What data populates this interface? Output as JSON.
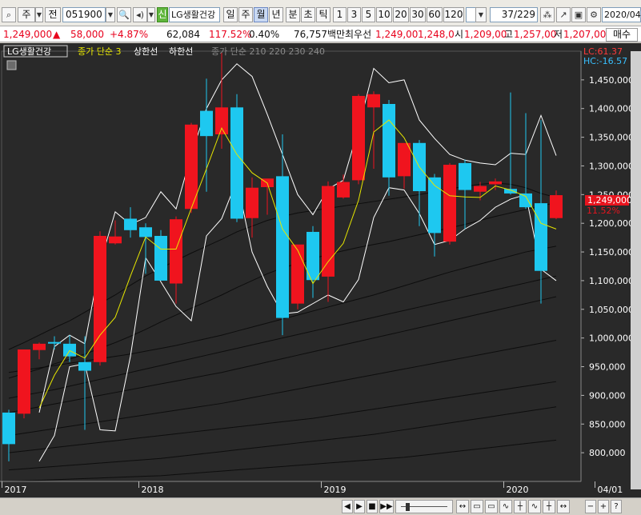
{
  "toolbar": {
    "type_label": "주",
    "jeon_label": "전",
    "code_value": "051900",
    "shin_label": "신",
    "stock_name": "LG생활건강",
    "period_tabs": [
      "일",
      "주",
      "월",
      "년"
    ],
    "active_tab": "월",
    "interval_tabs": [
      "분",
      "초",
      "틱"
    ],
    "number_tabs": [
      "1",
      "3",
      "5",
      "10",
      "20",
      "30",
      "60",
      "120"
    ],
    "page_counter": "37",
    "page_total": "/229",
    "date_value": "2020/04"
  },
  "price_info": {
    "price": "1,249,000",
    "change_arrow": "▲",
    "change": "58,000",
    "change_rate": "+4.87%",
    "volume": "62,084",
    "volume_ratio": "117.52%",
    "turnover": "0.40%",
    "amount": "76,757백만",
    "best_ask_label": "최우선",
    "best_ask": "1,249,00",
    "best_bid": "1,248,0",
    "open_label": "시",
    "open": "1,209,00",
    "high_label": "고",
    "high": "1,257,00",
    "low_label": "저",
    "low": "1,207,00",
    "buy_label": "매수"
  },
  "legend": {
    "stock_name": "LG생활건강",
    "ma_label": "종가 단순 3",
    "upper_label": "상한선",
    "lower_label": "하한선",
    "long_ma_label": "종가 단순 210  220  230  240"
  },
  "readout": {
    "lc": "LC:61.37",
    "hc": "HC:-16.57"
  },
  "current_price_label": {
    "price": "1,249,000",
    "pct": "11.52%"
  },
  "bottom_bar": {
    "buttons": [
      "◀",
      "▶",
      "■",
      "▶▶"
    ],
    "tool_glyphs": [
      "↔",
      "▭",
      "▭",
      "∿",
      "┼",
      "∿",
      "┼",
      "↔",
      "−",
      "+",
      "?"
    ]
  },
  "colors": {
    "up": "#f0141e",
    "down": "#1ec8f0",
    "ma": "#e6e600",
    "band": "#ffffff",
    "background": "#292929"
  },
  "chart_data": {
    "type": "candlestick",
    "ylim": [
      750000,
      1500000
    ],
    "y_ticks": [
      800000,
      850000,
      900000,
      950000,
      1000000,
      1050000,
      1100000,
      1150000,
      1200000,
      1250000,
      1300000,
      1350000,
      1400000,
      1450000
    ],
    "y_tick_labels": [
      "800,000",
      "850,000",
      "900,000",
      "950,000",
      "1,000,000",
      "1,050,000",
      "1,100,000",
      "1,150,000",
      "1,200,000",
      "1,250,000",
      "1,300,000",
      "1,350,000",
      "1,400,000",
      "1,450,000"
    ],
    "x_labels": [
      {
        "label": "2017",
        "index": 0
      },
      {
        "label": "2018",
        "index": 9
      },
      {
        "label": "2019",
        "index": 21
      },
      {
        "label": "2020",
        "index": 33
      },
      {
        "label": "04/01",
        "index": 39
      }
    ],
    "candles": [
      {
        "o": 870000,
        "h": 875000,
        "l": 785000,
        "c": 815000
      },
      {
        "o": 868000,
        "h": 980000,
        "l": 860000,
        "c": 980000
      },
      {
        "o": 979000,
        "h": 992000,
        "l": 963000,
        "c": 990000
      },
      {
        "o": 993000,
        "h": 1003000,
        "l": 980000,
        "c": 992000
      },
      {
        "o": 990000,
        "h": 1005000,
        "l": 958000,
        "c": 968000
      },
      {
        "o": 958000,
        "h": 1003000,
        "l": 840000,
        "c": 943000
      },
      {
        "o": 958000,
        "h": 1186000,
        "l": 952000,
        "c": 1178000
      },
      {
        "o": 1165000,
        "h": 1205000,
        "l": 1163000,
        "c": 1177000
      },
      {
        "o": 1208000,
        "h": 1228000,
        "l": 1175000,
        "c": 1188000
      },
      {
        "o": 1193000,
        "h": 1200000,
        "l": 1112000,
        "c": 1176000
      },
      {
        "o": 1178000,
        "h": 1188000,
        "l": 1100000,
        "c": 1100000
      },
      {
        "o": 1095000,
        "h": 1212000,
        "l": 1060000,
        "c": 1207000
      },
      {
        "o": 1225000,
        "h": 1375000,
        "l": 1218000,
        "c": 1372000
      },
      {
        "o": 1396000,
        "h": 1452000,
        "l": 1255000,
        "c": 1352000
      },
      {
        "o": 1355000,
        "h": 1497000,
        "l": 1330000,
        "c": 1402000
      },
      {
        "o": 1402000,
        "h": 1425000,
        "l": 1202000,
        "c": 1208000
      },
      {
        "o": 1209000,
        "h": 1280000,
        "l": 1175000,
        "c": 1262000
      },
      {
        "o": 1263000,
        "h": 1275000,
        "l": 1215000,
        "c": 1278000
      },
      {
        "o": 1282000,
        "h": 1355000,
        "l": 1005000,
        "c": 1035000
      },
      {
        "o": 1060000,
        "h": 1160000,
        "l": 1050000,
        "c": 1163000
      },
      {
        "o": 1185000,
        "h": 1195000,
        "l": 1070000,
        "c": 1101000
      },
      {
        "o": 1107000,
        "h": 1273000,
        "l": 1063000,
        "c": 1265000
      },
      {
        "o": 1245000,
        "h": 1285000,
        "l": 1243000,
        "c": 1272000
      },
      {
        "o": 1275000,
        "h": 1425000,
        "l": 1268000,
        "c": 1422000
      },
      {
        "o": 1402000,
        "h": 1430000,
        "l": 1295000,
        "c": 1425000
      },
      {
        "o": 1408000,
        "h": 1415000,
        "l": 1248000,
        "c": 1280000
      },
      {
        "o": 1282000,
        "h": 1336000,
        "l": 1260000,
        "c": 1340000
      },
      {
        "o": 1340000,
        "h": 1345000,
        "l": 1195000,
        "c": 1256000
      },
      {
        "o": 1280000,
        "h": 1286000,
        "l": 1142000,
        "c": 1183000
      },
      {
        "o": 1168000,
        "h": 1305000,
        "l": 1163000,
        "c": 1302000
      },
      {
        "o": 1305000,
        "h": 1311000,
        "l": 1190000,
        "c": 1258000
      },
      {
        "o": 1255000,
        "h": 1272000,
        "l": 1240000,
        "c": 1265000
      },
      {
        "o": 1268000,
        "h": 1278000,
        "l": 1258000,
        "c": 1273000
      },
      {
        "o": 1260000,
        "h": 1428000,
        "l": 1250000,
        "c": 1252000
      },
      {
        "o": 1252000,
        "h": 1392000,
        "l": 1225000,
        "c": 1228000
      },
      {
        "o": 1235000,
        "h": 1380000,
        "l": 1060000,
        "c": 1117000
      },
      {
        "o": 1209000,
        "h": 1257000,
        "l": 1207000,
        "c": 1249000
      }
    ],
    "ma": [
      null,
      null,
      878000,
      935000,
      978000,
      965000,
      1005000,
      1036000,
      1108000,
      1176000,
      1155000,
      1155000,
      1226000,
      1295000,
      1366000,
      1320000,
      1288000,
      1270000,
      1190000,
      1153000,
      1095000,
      1133000,
      1165000,
      1240000,
      1359000,
      1380000,
      1349000,
      1298000,
      1266000,
      1248000,
      1246000,
      1245000,
      1265000,
      1258000,
      1247000,
      1200000,
      1190000
    ],
    "upper": [
      null,
      null,
      870000,
      985000,
      1005000,
      990000,
      1130000,
      1220000,
      1198000,
      1210000,
      1255000,
      1225000,
      1320000,
      1400000,
      1450000,
      1478000,
      1456000,
      1390000,
      1320000,
      1250000,
      1215000,
      1260000,
      1275000,
      1365000,
      1470000,
      1445000,
      1450000,
      1380000,
      1348000,
      1320000,
      1310000,
      1305000,
      1302000,
      1322000,
      1320000,
      1388000,
      1318000
    ],
    "lower": [
      null,
      null,
      785000,
      830000,
      950000,
      955000,
      840000,
      838000,
      968000,
      1140000,
      1098000,
      1055000,
      1030000,
      1178000,
      1208000,
      1275000,
      1150000,
      1090000,
      1042000,
      1045000,
      1060000,
      1075000,
      1063000,
      1102000,
      1210000,
      1262000,
      1258000,
      1217000,
      1163000,
      1170000,
      1190000,
      1205000,
      1228000,
      1242000,
      1250000,
      1120000,
      1100000
    ],
    "long_ma_lines": [
      [
        980000,
        992000,
        1005000,
        1018000,
        1030000,
        1045000,
        1060000,
        1075000,
        1092000,
        1108000,
        1122000,
        1135000,
        1148000,
        1160000,
        1172000,
        1185000,
        1195000,
        1205000,
        1212000,
        1218000,
        1222000,
        1226000,
        1230000,
        1234000,
        1238000,
        1242000,
        1246000,
        1250000,
        1255000,
        1260000,
        1264000,
        1268000,
        1270000,
        1268000,
        1262000,
        1252000,
        1245000
      ],
      [
        930000,
        938000,
        946000,
        955000,
        963000,
        972000,
        982000,
        992000,
        1003000,
        1015000,
        1028000,
        1040000,
        1052000,
        1063000,
        1075000,
        1088000,
        1100000,
        1112000,
        1122000,
        1130000,
        1138000,
        1146000,
        1152000,
        1158000,
        1163000,
        1168000,
        1174000,
        1180000,
        1186000,
        1192000,
        1198000,
        1205000,
        1212000,
        1218000,
        1224000,
        1230000,
        1236000
      ],
      [
        940000,
        944000,
        948000,
        952000,
        956000,
        960000,
        964000,
        968000,
        972000,
        977000,
        982000,
        987000,
        993000,
        999000,
        1005000,
        1012000,
        1019000,
        1026000,
        1033000,
        1040000,
        1047000,
        1054000,
        1061000,
        1068000,
        1075000,
        1083000,
        1091000,
        1099000,
        1107000,
        1115000,
        1122000,
        1129000,
        1136000,
        1143000,
        1150000,
        1155000,
        1160000
      ],
      [
        895000,
        900000,
        905000,
        910000,
        916000,
        922000,
        928000,
        934000,
        940000,
        946000,
        952000,
        958000,
        964000,
        970000,
        976000,
        982000,
        988000,
        994000,
        1000000,
        1006000,
        1012000,
        1018000,
        1024000,
        1030000,
        1036000,
        1042000,
        1048000,
        1054000,
        1060000,
        1066000,
        1072000,
        1078000,
        1084000,
        1090000,
        1096000,
        1102000,
        1108000
      ],
      [
        870000,
        875000,
        880000,
        885000,
        890000,
        895000,
        900000,
        905000,
        910000,
        915000,
        920000,
        925000,
        930000,
        935000,
        940000,
        946000,
        952000,
        958000,
        964000,
        970000,
        976000,
        982000,
        988000,
        994000,
        1000000,
        1006000,
        1012000,
        1018000,
        1024000,
        1030000,
        1036000,
        1042000,
        1048000,
        1054000,
        1060000,
        1066000,
        1072000
      ],
      [
        830000,
        834000,
        838000,
        842000,
        846000,
        850000,
        854000,
        858000,
        862000,
        866000,
        870000,
        874000,
        878000,
        882000,
        886000,
        891000,
        896000,
        901000,
        906000,
        911000,
        916000,
        921000,
        926000,
        931000,
        936000,
        941000,
        946000,
        951000,
        956000,
        961000,
        966000,
        971000,
        976000,
        981000,
        986000,
        991000,
        996000
      ],
      [
        800000,
        803000,
        806000,
        809000,
        812000,
        815000,
        818000,
        821000,
        824000,
        827000,
        830000,
        833000,
        836000,
        839000,
        842000,
        845000,
        848000,
        851000,
        854000,
        857000,
        860000,
        864000,
        868000,
        872000,
        876000,
        880000,
        884000,
        888000,
        892000,
        896000,
        900000,
        904000,
        908000,
        912000,
        916000,
        920000,
        924000
      ],
      [
        770000,
        772000,
        774000,
        776000,
        778000,
        780000,
        782000,
        784000,
        786000,
        788000,
        790000,
        793000,
        796000,
        799000,
        802000,
        805000,
        808000,
        811000,
        814000,
        817000,
        820000,
        823000,
        826000,
        829000,
        832000,
        836000,
        840000,
        844000,
        848000,
        852000,
        856000,
        860000,
        864000,
        868000,
        872000,
        876000,
        880000
      ],
      [
        750000,
        751000,
        752000,
        753000,
        754000,
        755000,
        756000,
        757000,
        758000,
        759000,
        760000,
        762000,
        764000,
        766000,
        768000,
        770000,
        772000,
        774000,
        776000,
        778000,
        780000,
        782000,
        784000,
        786000,
        788000,
        790000,
        792000,
        795000,
        798000,
        801000,
        804000,
        807000,
        810000,
        813000,
        816000,
        819000,
        822000
      ]
    ]
  }
}
